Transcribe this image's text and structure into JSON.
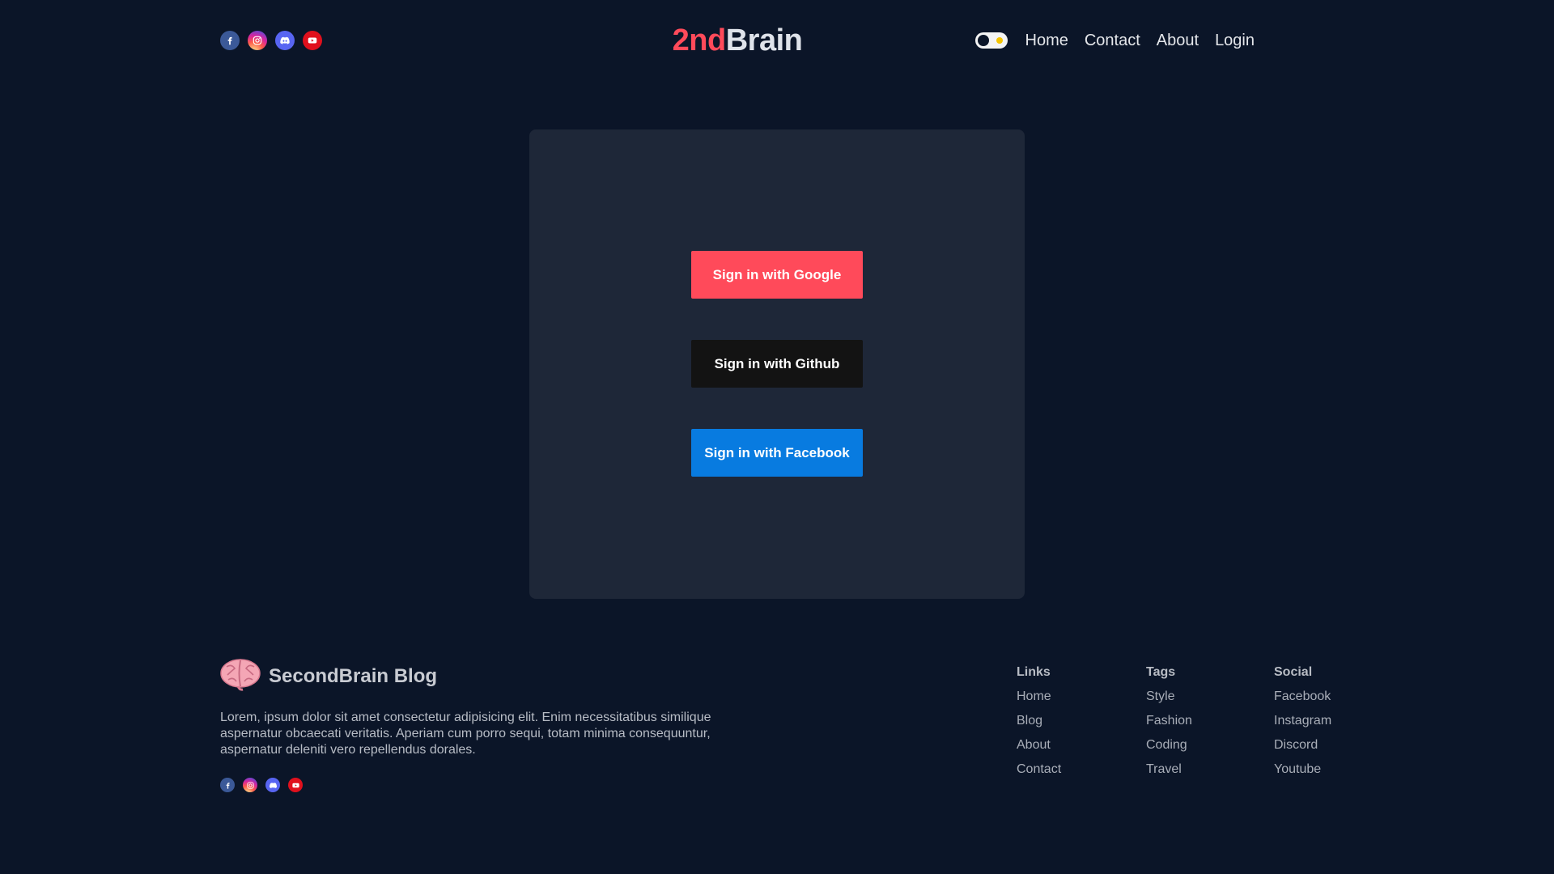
{
  "header": {
    "social_icons": [
      "facebook-icon",
      "instagram-icon",
      "discord-icon",
      "youtube-icon"
    ],
    "logo": {
      "part1": "2nd",
      "part2": "Brain"
    },
    "nav": [
      "Home",
      "Contact",
      "About",
      "Login"
    ]
  },
  "auth": {
    "google": "Sign in with Google",
    "github": "Sign in with Github",
    "facebook": "Sign in with Facebook"
  },
  "footer": {
    "brand": "SecondBrain Blog",
    "description": "Lorem, ipsum dolor sit amet consectetur adipisicing elit. Enim necessitatibus similique aspernatur obcaecati veritatis. Aperiam cum porro sequi, totam minima consequuntur, aspernatur deleniti vero repellendus dorales.",
    "columns": [
      {
        "title": "Links",
        "items": [
          "Home",
          "Blog",
          "About",
          "Contact"
        ]
      },
      {
        "title": "Tags",
        "items": [
          "Style",
          "Fashion",
          "Coding",
          "Travel"
        ]
      },
      {
        "title": "Social",
        "items": [
          "Facebook",
          "Instagram",
          "Discord",
          "Youtube"
        ]
      }
    ]
  },
  "colors": {
    "background": "#0b1528",
    "card": "#1e2738",
    "accent": "#ff4a5a",
    "github": "#131313",
    "facebook": "#087be0"
  }
}
